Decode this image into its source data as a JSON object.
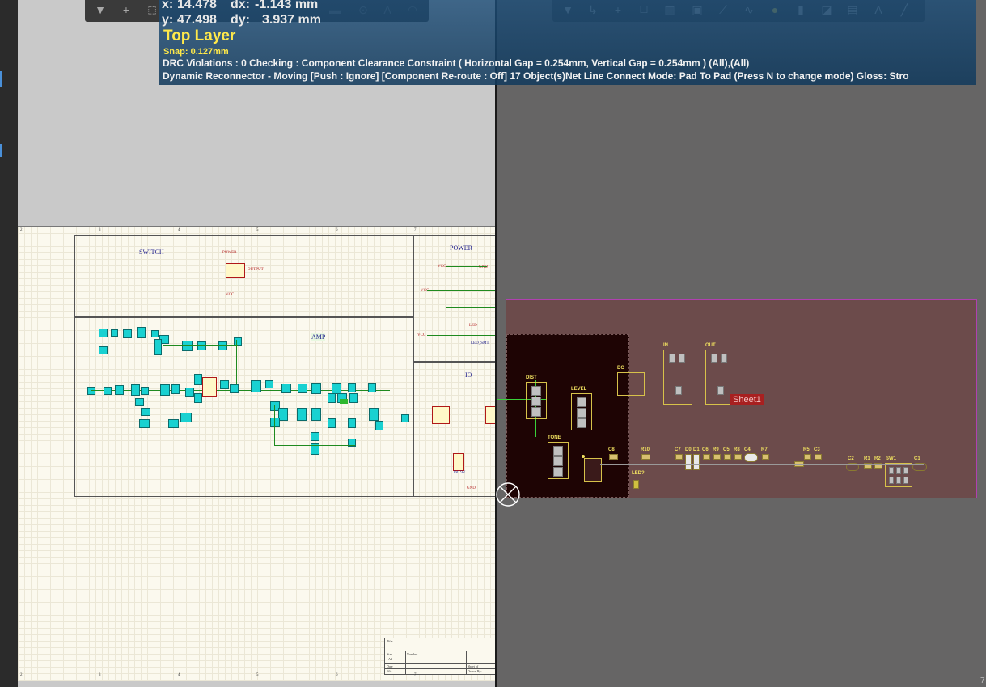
{
  "overlay": {
    "x_label": "x:",
    "x_value": "14.478",
    "dx_label": "dx:",
    "dx_value": "-1.143 mm",
    "y_label": "y:",
    "y_value": "47.498",
    "dy_label": "dy:",
    "dy_value": "3.937 mm",
    "layer": "Top Layer",
    "snap": "Snap: 0.127mm",
    "drc": "DRC Violations : 0 Checking : Component Clearance Constraint ( Horizontal Gap = 0.254mm, Vertical Gap = 0.254mm ) (All),(All)",
    "dynamic": "Dynamic Reconnector - Moving [Push : Ignore] [Component Re-route : Off] 17 Object(s)Net Line Connect Mode: Pad To Pad (Press N to change mode) Gloss: Stro"
  },
  "left_toolbar": {
    "icons": [
      "filter-icon",
      "plus-icon",
      "select-rect-icon"
    ]
  },
  "right_toolbar": {
    "icons": [
      "filter-icon",
      "route-icon",
      "plus-icon",
      "select-rect-icon",
      "align-icon",
      "chip-icon",
      "interactive-route-icon",
      "diff-pair-icon",
      "pin-icon",
      "fill-icon",
      "region-icon",
      "image-icon",
      "text-icon",
      "line-icon"
    ]
  },
  "schematic": {
    "zones": {
      "switch": "SWITCH",
      "power": "POWER",
      "amp": "AMP",
      "io": "IO"
    },
    "ruler": [
      "2",
      "3",
      "4",
      "5",
      "6",
      "7"
    ],
    "labels": {
      "power_net": "POWER",
      "vcc": "VCC",
      "gnd": "GND",
      "led": "LED",
      "led_smt": "LED_SMT",
      "output": "OUTPUT",
      "dc9v": "DC 9V"
    },
    "title_block": {
      "title": "Title",
      "size": "Size",
      "size_val": "A4",
      "number": "Number",
      "date": "Date",
      "file": "File",
      "sheet": "Sheet   of",
      "drawn": "Drawn By:"
    }
  },
  "pcb": {
    "designators": [
      "DIST",
      "LEVEL",
      "TONE",
      "DC",
      "IN",
      "OUT",
      "C8",
      "R10",
      "C7",
      "D0",
      "D1",
      "C6",
      "R9",
      "C5",
      "R8",
      "C4",
      "R7",
      "R5",
      "C3",
      "C2",
      "R1",
      "R2",
      "SW1",
      "C1",
      "LED?"
    ],
    "sheet_tag": "Sheet1",
    "corner_glyph": "7"
  },
  "colors": {
    "overlay_bg": "#1c4d78",
    "layer_yellow": "#ffe94a",
    "board": "#6c4b4b",
    "board_outline": "#b040b0",
    "pad_cyan": "#19d1d1",
    "silk_yellow": "#d7c24a",
    "sheet_red": "#a82020"
  }
}
